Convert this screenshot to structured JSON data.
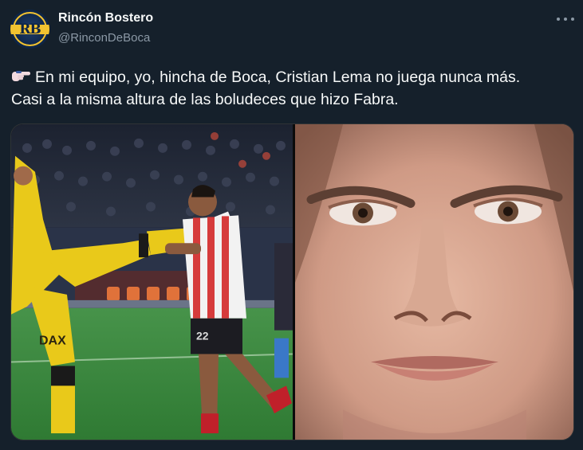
{
  "tweet": {
    "display_name": "Rincón Bostero",
    "handle": "@RinconDeBoca",
    "avatar_monogram": "RB",
    "lines": [
      "En mi equipo, yo, hincha de Boca, Cristian Lema no juega nunca más.",
      "Casi a la misma altura de las boludeces que hizo Fabra."
    ],
    "emoji": "pointing-right-hand-icon"
  },
  "media": {
    "left_sponsor_text": "DAX",
    "colors": {
      "boca_yellow": "#e9c91a",
      "rival_red": "#d63b3b",
      "pitch_green": "#3b8c3a"
    }
  }
}
